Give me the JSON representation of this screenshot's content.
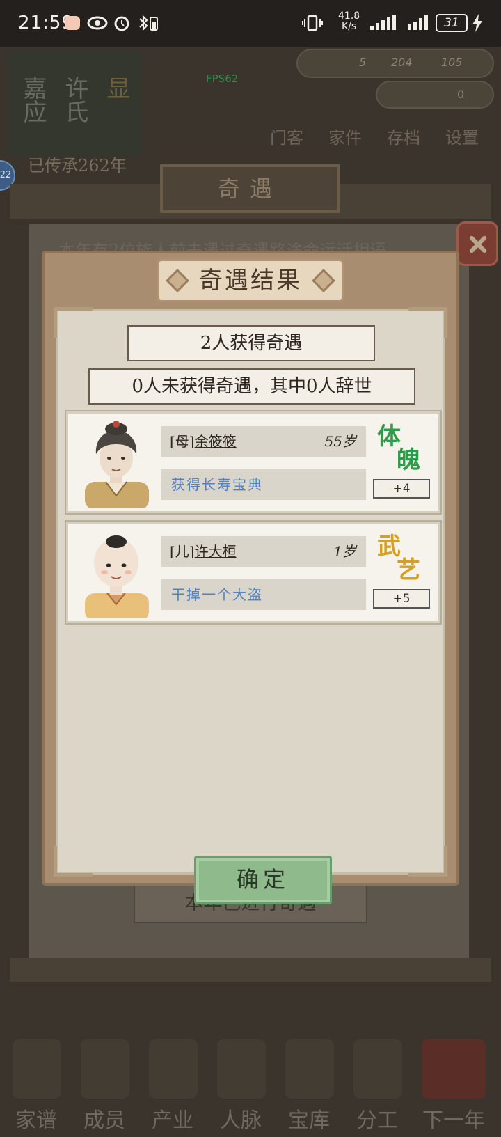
{
  "status_bar": {
    "time": "21:59",
    "net_speed_value": "41.8",
    "net_speed_unit": "K/s",
    "battery": "31",
    "icons": [
      "app-icon",
      "eye-icon",
      "alarm-icon",
      "bluetooth-battery-icon",
      "vibrate-icon",
      "signal-icon",
      "signal-icon",
      "charging-icon"
    ]
  },
  "background": {
    "fps": "FPS62",
    "clan_plaques": [
      "嘉应",
      "许氏",
      "显"
    ],
    "years_text": "已传承262年",
    "resource_values": [
      "5",
      "204",
      "105",
      "0"
    ],
    "top_nav": [
      "门客",
      "家件",
      "存档",
      "设置"
    ],
    "side_badge": "22",
    "under_title": "奇遇",
    "under_text": "本年有2位族人前去遇过奇遇路途命运话相语",
    "under_done": "本年已进行奇遇",
    "bottom_nav": [
      "家谱",
      "成员",
      "产业",
      "人脉",
      "宝库",
      "分工",
      "下一年"
    ]
  },
  "dialog": {
    "title": "奇遇结果",
    "got_summary": "2人获得奇遇",
    "missed_summary": "0人未获得奇遇，其中0人辞世",
    "results": [
      {
        "relation": "[母]",
        "name": "余筱筱",
        "age": "55岁",
        "event": "获得长寿宝典",
        "attribute": [
          "体",
          "魄"
        ],
        "attribute_color": "#2f9a4a",
        "bonus": "+4"
      },
      {
        "relation": "[儿]",
        "name": "许大桓",
        "age": "1岁",
        "event": "干掉一个大盗",
        "attribute": [
          "武",
          "艺"
        ],
        "attribute_color": "#d6a022",
        "bonus": "+5"
      }
    ],
    "confirm_label": "确定"
  }
}
